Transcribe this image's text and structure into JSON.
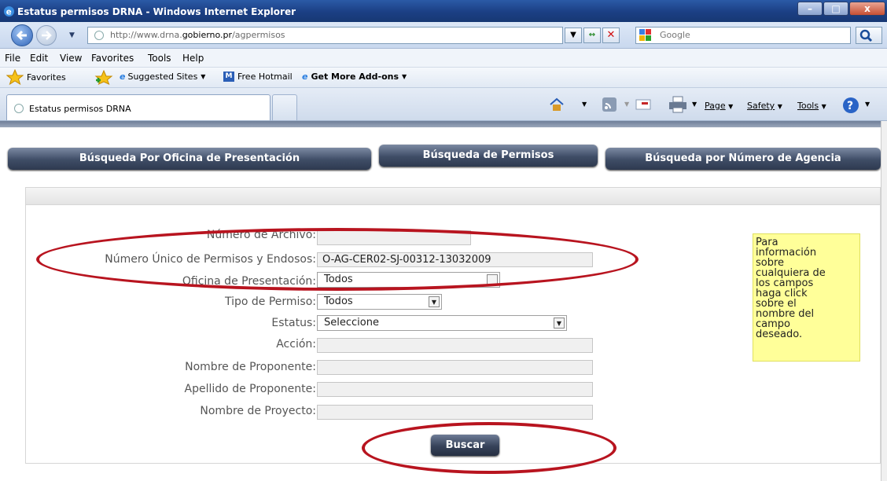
{
  "window": {
    "title": "Estatus permisos DRNA - Windows Internet Explorer",
    "buttons": {
      "minimize": "–",
      "maximize": "□",
      "close": "x"
    }
  },
  "address": {
    "url_prefix": "http://www.drna.",
    "url_domain": "gobierno.pr",
    "url_path": "/agpermisos",
    "search_placeholder": "Google"
  },
  "menu": [
    "File",
    "Edit",
    "View",
    "Favorites",
    "Tools",
    "Help"
  ],
  "favorites": {
    "favorites": "Favorites",
    "suggested": "Suggested Sites",
    "hotmail": "Free Hotmail",
    "addons": "Get More Add-ons"
  },
  "tab": {
    "title": "Estatus permisos DRNA"
  },
  "commands": {
    "page": "Page",
    "safety": "Safety",
    "tools": "Tools"
  },
  "nav": {
    "tab1": "Búsqueda Por Oficina de Presentación",
    "tab2": "Búsqueda de Permisos",
    "tab3": "Búsqueda por Número de Agencia"
  },
  "form": {
    "archivo_label": "Número de Archivo:",
    "archivo_value": "",
    "unico_label": "Número Único de Permisos y Endosos:",
    "unico_value": "O-AG-CER02-SJ-00312-13032009",
    "oficina_label": "Oficina de Presentación:",
    "oficina_value": "Todos",
    "tipo_label": "Tipo de Permiso:",
    "tipo_value": "Todos",
    "estatus_label": "Estatus:",
    "estatus_value": "Seleccione",
    "accion_label": "Acción:",
    "accion_value": "",
    "nombre_label": "Nombre de Proponente:",
    "nombre_value": "",
    "apellido_label": "Apellido de Proponente:",
    "apellido_value": "",
    "proyecto_label": "Nombre de Proyecto:",
    "proyecto_value": "",
    "submit": "Buscar"
  },
  "help": [
    "Para",
    "información",
    "sobre",
    "cualquiera de",
    "los campos",
    "haga click",
    "sobre el",
    "nombre del",
    "campo",
    "deseado."
  ],
  "colors": {
    "annotation": "#b8141f",
    "help_bg": "#ffff99",
    "button_dark": "#364259"
  }
}
